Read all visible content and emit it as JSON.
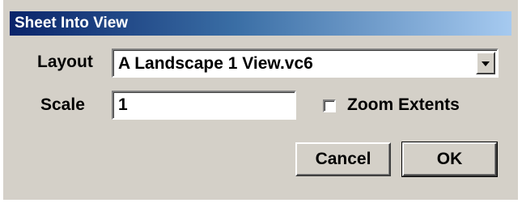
{
  "dialog": {
    "title": "Sheet Into View",
    "layout": {
      "label": "Layout",
      "selected_value": "A Landscape 1 View.vc6"
    },
    "scale": {
      "label": "Scale",
      "value": "1"
    },
    "zoom_extents": {
      "label": "Zoom Extents",
      "checked": false
    },
    "buttons": {
      "cancel_label": "Cancel",
      "ok_label": "OK"
    }
  },
  "icons": {
    "dropdown": "chevron-down-icon"
  },
  "colors": {
    "dialog_face": "#d4d0c8",
    "titlebar_start": "#0a246a",
    "titlebar_end": "#a6caf0",
    "field_background": "#ffffff",
    "text": "#000000"
  }
}
